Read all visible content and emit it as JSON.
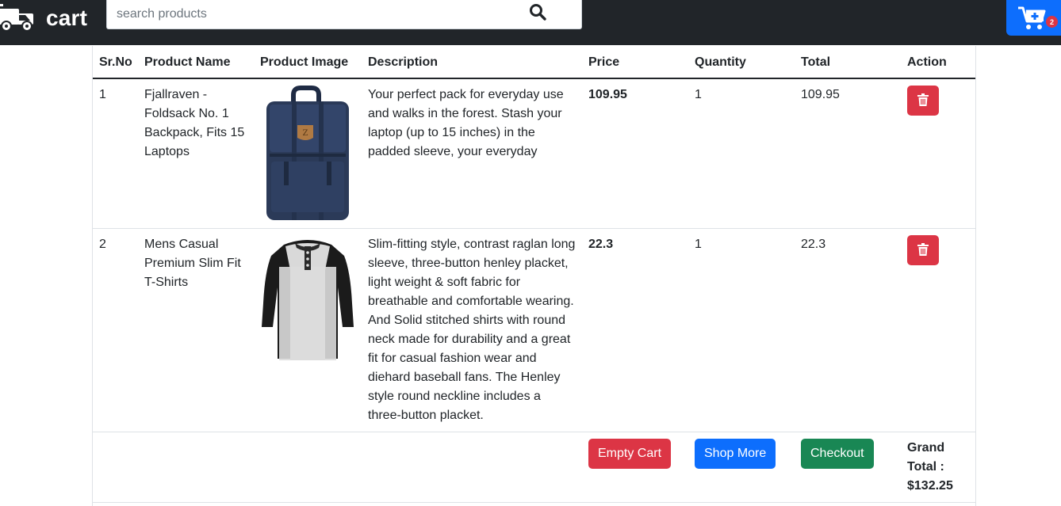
{
  "brand": {
    "name": "cart"
  },
  "search": {
    "placeholder": "search products"
  },
  "cart": {
    "count": "2"
  },
  "table": {
    "headers": [
      "Sr.No",
      "Product Name",
      "Product Image",
      "Description",
      "Price",
      "Quantity",
      "Total",
      "Action"
    ],
    "rows": [
      {
        "sr": "1",
        "name": "Fjallraven - Foldsack No. 1 Backpack, Fits 15 Laptops",
        "description": "Your perfect pack for everyday use and walks in the forest. Stash your laptop (up to 15 inches) in the padded sleeve, your everyday",
        "price": "109.95",
        "quantity": "1",
        "total": "109.95",
        "image": "backpack-image"
      },
      {
        "sr": "2",
        "name": "Mens Casual Premium Slim Fit T-Shirts",
        "description": "Slim-fitting style, contrast raglan long sleeve, three-button henley placket, light weight & soft fabric for breathable and comfortable wearing. And Solid stitched shirts with round neck made for durability and a great fit for casual fashion wear and diehard baseball fans. The Henley style round neckline includes a three-button placket.",
        "price": "22.3",
        "quantity": "1",
        "total": "22.3",
        "image": "tshirt-image"
      }
    ]
  },
  "footer": {
    "empty_cart": "Empty Cart",
    "shop_more": "Shop More",
    "checkout": "Checkout",
    "grand_total_label_1": "Grand",
    "grand_total_label_2": "Total :",
    "grand_total_value": "$132.25"
  },
  "colors": {
    "navbar": "#212529",
    "primary": "#0d6efd",
    "danger": "#dc3545",
    "success": "#198754"
  },
  "icons": {
    "brand": "truck-icon",
    "search": "search-icon",
    "cart": "cart-plus-icon",
    "delete": "trash-icon"
  }
}
